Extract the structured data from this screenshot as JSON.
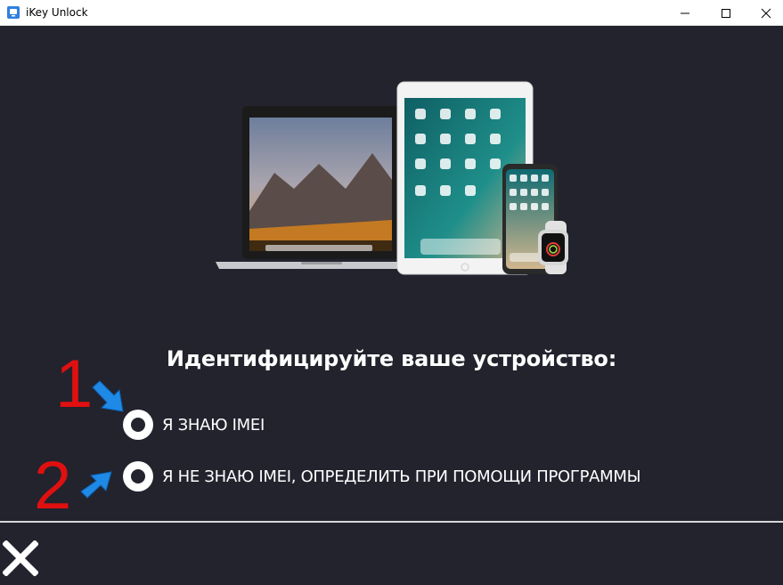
{
  "window": {
    "title": "iKey Unlock",
    "icons": {
      "app": "app-icon",
      "minimize": "minimize-icon",
      "maximize": "maximize-icon",
      "close": "close-icon"
    }
  },
  "main": {
    "heading": "Идентифицируйте ваше устройство:",
    "options": [
      {
        "label": "Я ЗНАЮ IMEI",
        "selected": false
      },
      {
        "label": "Я НЕ ЗНАЮ IMEI, ОПРЕДЕЛИТЬ ПРИ ПОМОЩИ ПРОГРАММЫ",
        "selected": false
      }
    ],
    "annotations": [
      {
        "number": "1",
        "color": "#e01010",
        "arrow": "arrow-down-right-icon"
      },
      {
        "number": "2",
        "color": "#e01010",
        "arrow": "arrow-up-right-icon"
      }
    ]
  },
  "footer": {
    "close_icon": "close-x-icon"
  },
  "colors": {
    "background": "#22232d",
    "text": "#ffffff",
    "accent": "#e01010",
    "arrow": "#1e8ae6"
  }
}
